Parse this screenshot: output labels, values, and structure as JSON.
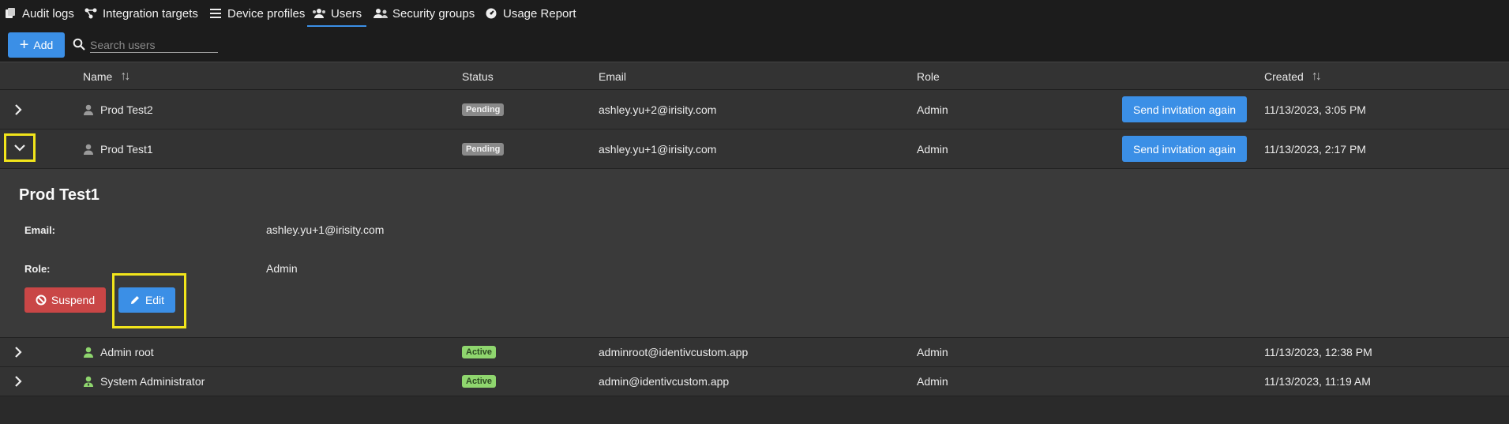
{
  "tabs": [
    {
      "label": "Audit logs",
      "icon": "audit-logs-icon"
    },
    {
      "label": "Integration targets",
      "icon": "integration-icon"
    },
    {
      "label": "Device profiles",
      "icon": "list-icon"
    },
    {
      "label": "Users",
      "icon": "users-icon",
      "active": true
    },
    {
      "label": "Security groups",
      "icon": "security-groups-icon"
    },
    {
      "label": "Usage Report",
      "icon": "gauge-icon"
    }
  ],
  "toolbar": {
    "add_label": "Add",
    "search_placeholder": "Search users"
  },
  "columns": {
    "name": "Name",
    "status": "Status",
    "email": "Email",
    "role": "Role",
    "created": "Created"
  },
  "rows": [
    {
      "name": "Prod Test2",
      "status": "Pending",
      "email": "ashley.yu+2@irisity.com",
      "role": "Admin",
      "action": "Send invitation again",
      "created": "11/13/2023, 3:05 PM"
    },
    {
      "name": "Prod Test1",
      "status": "Pending",
      "email": "ashley.yu+1@irisity.com",
      "role": "Admin",
      "action": "Send invitation again",
      "created": "11/13/2023, 2:17 PM",
      "expanded": true
    },
    {
      "name": "Admin root",
      "status": "Active",
      "email": "adminroot@identivcustom.app",
      "role": "Admin",
      "created": "11/13/2023, 12:38 PM"
    },
    {
      "name": "System Administrator",
      "status": "Active",
      "email": "admin@identivcustom.app",
      "role": "Admin",
      "created": "11/13/2023, 11:19 AM"
    }
  ],
  "detail": {
    "title": "Prod Test1",
    "email_label": "Email:",
    "email_value": "ashley.yu+1@irisity.com",
    "role_label": "Role:",
    "role_value": "Admin",
    "suspend_label": "Suspend",
    "edit_label": "Edit"
  },
  "colors": {
    "accent": "#3b8fe6",
    "danger": "#c94646",
    "active_badge": "#8fd66e",
    "pending_badge": "#8a8a8a",
    "highlight": "#f2e51b"
  }
}
